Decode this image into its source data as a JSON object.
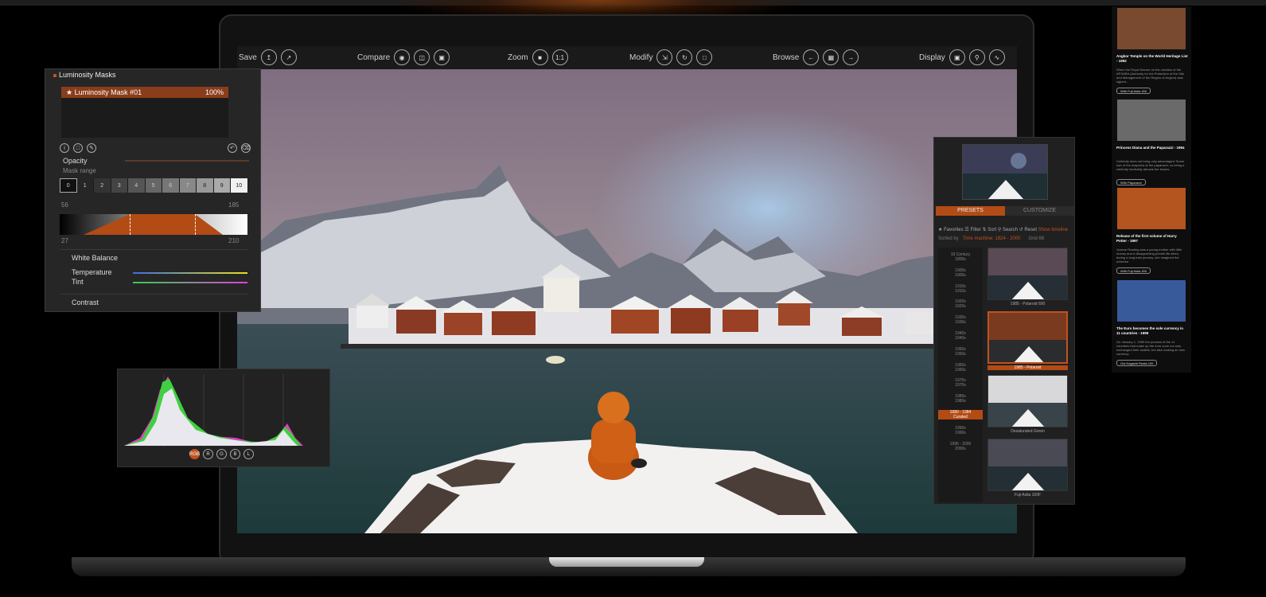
{
  "toolbar": {
    "save_label": "Save",
    "compare_label": "Compare",
    "zoom_label": "Zoom",
    "zoom_ratio": "1:1",
    "modify_label": "Modify",
    "browse_label": "Browse",
    "display_label": "Display"
  },
  "masks_panel": {
    "title": "Luminosity Masks",
    "mask_name": "Luminosity Mask #01",
    "mask_percent": "100%",
    "opacity_label": "Opacity",
    "mask_range_label": "Mask range",
    "range_values": [
      "0",
      "1",
      "2",
      "3",
      "4",
      "5",
      "6",
      "7",
      "8",
      "9",
      "10"
    ],
    "low_value": "56",
    "high_value": "185",
    "low_bottom": "27",
    "high_bottom": "210",
    "white_balance_label": "White Balance",
    "temperature_label": "Temperature",
    "tint_label": "Tint",
    "contrast_label": "Contrast"
  },
  "histogram": {
    "buttons": [
      "RGB",
      "R",
      "G",
      "B",
      "L"
    ]
  },
  "presets_panel": {
    "tab_presets": "PRESETS",
    "tab_customize": "CUSTOMIZE",
    "filters": [
      "Favorites",
      "Filter",
      "Sort",
      "Search",
      "Reset"
    ],
    "filter_extra": "Show timeline",
    "sorted_by": "Sorted by",
    "timeline_label": "Time machine: 1824 - 2000",
    "count": "Grid 66",
    "timeline": [
      {
        "y": "19 Century",
        "t": "1800s"
      },
      {
        "y": "1900s",
        "t": "1900s"
      },
      {
        "y": "1910s",
        "t": "1910s"
      },
      {
        "y": "1920s",
        "t": "1920s"
      },
      {
        "y": "1930s",
        "t": "1930s"
      },
      {
        "y": "1940s",
        "t": "1940s"
      },
      {
        "y": "1950s",
        "t": "1950s"
      },
      {
        "y": "1960s",
        "t": "1960s"
      },
      {
        "y": "1970s",
        "t": "1970s"
      },
      {
        "y": "1980s",
        "t": "1980s"
      },
      {
        "y": "1980 - 1984",
        "t": "Curated"
      },
      {
        "y": "1990s",
        "t": "1990s"
      },
      {
        "y": "1995 - 2000",
        "t": "2000s"
      }
    ],
    "thumbs": [
      {
        "caption": "1985 - Polaroid 600"
      },
      {
        "caption": "1985 - Polaroid"
      },
      {
        "caption": "Desaturated Green"
      },
      {
        "caption": "Fuji Astia 100F"
      }
    ]
  },
  "news": [
    {
      "title": "Angkor Temple on the World Heritage List - 1992",
      "text": "When the Royal Decree on the creation of the APSARA (Authority for the Protection of the Site and Management of the Region of Angkor) was signed...",
      "btn": "With Fuji Astia 400"
    },
    {
      "title": "Princess Diana and the Paparazzi - 1994",
      "text": "Celebrity does not bring only advantages! Some sort of the snapshot at the paparazzi, so being a celebrity inevitably attracts the lenses.",
      "btn": "With Paparazzi"
    },
    {
      "title": "Release of the first volume of Harry Potter - 1997",
      "text": "Joanne Rowling was a young mother with little money and a disappointing private life when, during a long train journey, she imagined the universe.",
      "btn": "With Fuji Astia 400"
    },
    {
      "title": "The Euro becomes the sole currency in 11 countries - 1999",
      "text": "On January 1, 1999 the process of the 11 countries that make up the euro zone not only exchanged their wallets, but also making an new currency.",
      "btn": "Out Kagachi Reala 100"
    }
  ],
  "colors": {
    "accent": "#c0521f",
    "panel": "#262626"
  }
}
